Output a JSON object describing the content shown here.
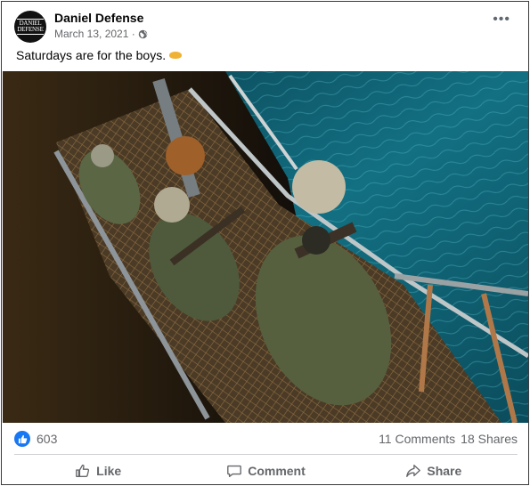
{
  "post": {
    "author": "Daniel Defense",
    "avatar_text": [
      "DANIEL",
      "DEFENSE"
    ],
    "date": "March 13, 2021 ·",
    "caption": "Saturdays are for the boys.",
    "caption_emoji": "oncoming-fist-emoji",
    "more_icon": "more-options-icon",
    "privacy_icon": "globe-icon"
  },
  "stats": {
    "likes": "603",
    "comments": "11 Comments",
    "shares": "18 Shares"
  },
  "actions": {
    "like": "Like",
    "comment": "Comment",
    "share": "Share"
  },
  "colors": {
    "facebook_blue": "#1877f2",
    "secondary_text": "#65676b",
    "sea": "#0f5566"
  }
}
